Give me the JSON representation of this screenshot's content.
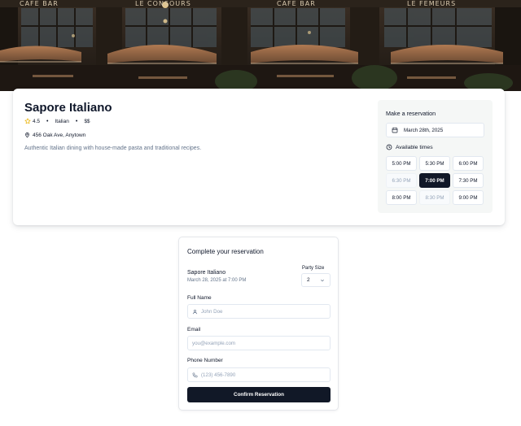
{
  "hero": {
    "signs": [
      "CAFE BAR",
      "LE CONSOURS",
      "CAFE BAR",
      "LE FEMEURS"
    ]
  },
  "restaurant": {
    "name": "Sapore Italiano",
    "rating": "4.5",
    "cuisine": "Italian",
    "price": "$$",
    "address": "456 Oak Ave, Anytown",
    "description": "Authentic Italian dining with house-made pasta and traditional recipes.",
    "meta_separator": "•"
  },
  "reservation_panel": {
    "title": "Make a reservation",
    "date": "March 28th, 2025",
    "available_label": "Available times",
    "slots": [
      {
        "time": "5:00 PM",
        "state": "available"
      },
      {
        "time": "5:30 PM",
        "state": "available"
      },
      {
        "time": "6:00 PM",
        "state": "available"
      },
      {
        "time": "6:30 PM",
        "state": "disabled"
      },
      {
        "time": "7:00 PM",
        "state": "selected"
      },
      {
        "time": "7:30 PM",
        "state": "available"
      },
      {
        "time": "8:00 PM",
        "state": "available"
      },
      {
        "time": "8:30 PM",
        "state": "disabled"
      },
      {
        "time": "9:00 PM",
        "state": "available"
      }
    ]
  },
  "form": {
    "title": "Complete your reservation",
    "summary_name": "Sapore Italiano",
    "summary_datetime": "March 28, 2025 at 7:00 PM",
    "party_size_label": "Party Size",
    "party_size_value": "2",
    "full_name_label": "Full Name",
    "full_name_placeholder": "John Doe",
    "email_label": "Email",
    "email_placeholder": "you@example.com",
    "phone_label": "Phone Number",
    "phone_placeholder": "(123) 456-7890",
    "submit_label": "Confirm Reservation"
  },
  "colors": {
    "primary": "#111827",
    "muted_text": "#64748b",
    "border": "#e2e8f0",
    "panel_bg": "#f5f7f6",
    "star": "#eab308"
  }
}
